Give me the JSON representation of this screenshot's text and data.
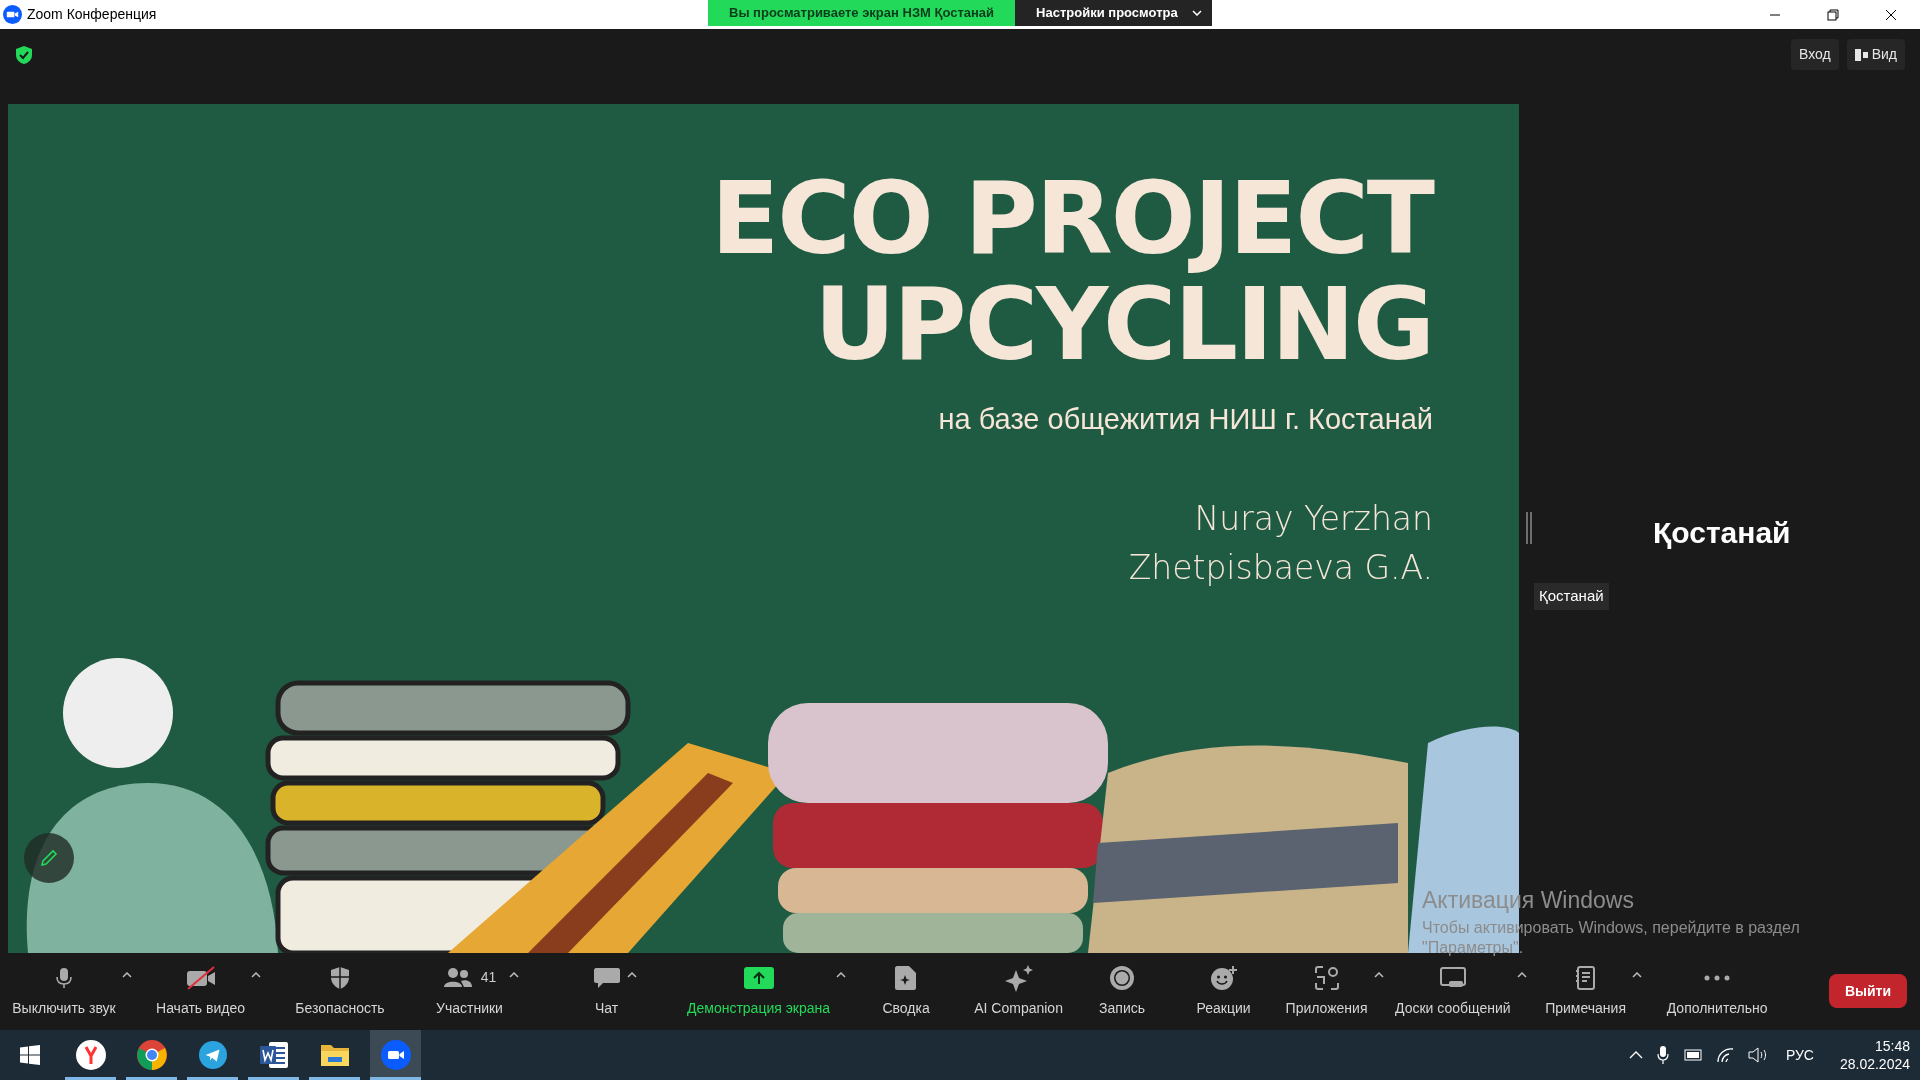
{
  "window": {
    "title": "Zoom Конференция"
  },
  "share_banner": {
    "status": "Вы просматриваете экран НЗМ Қостанай",
    "view_settings": "Настройки просмотра"
  },
  "top_bar": {
    "sign_in": "Вход",
    "view": "Вид"
  },
  "slide": {
    "title_lines": [
      "ECO PROJECT",
      "UPCYCLING"
    ],
    "subtitle": "на базе общежития НИШ г. Костанай",
    "authors": [
      "Nuray Yerzhan",
      "Zhetpisbaeva G.A."
    ]
  },
  "participant_panel": {
    "name": "Қостанай",
    "label": "Қостанай"
  },
  "activation_notice": {
    "title": "Активация Windows",
    "text": "Чтобы активировать Windows, перейдите в раздел",
    "text_2": "\"Параметры\"."
  },
  "toolbar": {
    "items": [
      {
        "kind": "mic",
        "label": "Выключить звук",
        "caret": true,
        "on": false
      },
      {
        "kind": "video-off",
        "label": "Начать видео",
        "caret": true,
        "on": false
      },
      {
        "kind": "shield",
        "label": "Безопасность",
        "caret": false,
        "on": false
      },
      {
        "kind": "people",
        "label": "Участники",
        "count": "41",
        "caret": true,
        "on": false
      },
      {
        "kind": "chat",
        "label": "Чат",
        "caret": true,
        "on": false
      },
      {
        "kind": "share",
        "label": "Демонстрация экрана",
        "caret": true,
        "on": true
      },
      {
        "kind": "summary",
        "label": "Сводка",
        "caret": false,
        "on": false
      },
      {
        "kind": "sparkle",
        "label": "AI Companion",
        "caret": false,
        "on": false
      },
      {
        "kind": "record",
        "label": "Запись",
        "caret": false,
        "on": false
      },
      {
        "kind": "reaction",
        "label": "Реакции",
        "caret": false,
        "on": false
      },
      {
        "kind": "apps",
        "label": "Приложения",
        "caret": true,
        "on": false
      },
      {
        "kind": "whiteboard",
        "label": "Доски сообщений",
        "caret": true,
        "on": false
      },
      {
        "kind": "notes",
        "label": "Примечания",
        "caret": true,
        "on": false
      },
      {
        "kind": "more",
        "label": "Дополнительно",
        "caret": false,
        "on": false
      }
    ],
    "leave": "Выйти"
  },
  "taskbar": {
    "apps": [
      {
        "kind": "start",
        "running": false,
        "selected": false
      },
      {
        "kind": "yandex",
        "running": true,
        "selected": false
      },
      {
        "kind": "chrome",
        "running": true,
        "selected": false
      },
      {
        "kind": "telegram",
        "running": true,
        "selected": false
      },
      {
        "kind": "word",
        "running": true,
        "selected": false
      },
      {
        "kind": "explorer",
        "running": true,
        "selected": false
      },
      {
        "kind": "zoom",
        "running": true,
        "selected": true
      }
    ],
    "language": "РУС",
    "time": "15:48",
    "date": "28.02.2024"
  }
}
